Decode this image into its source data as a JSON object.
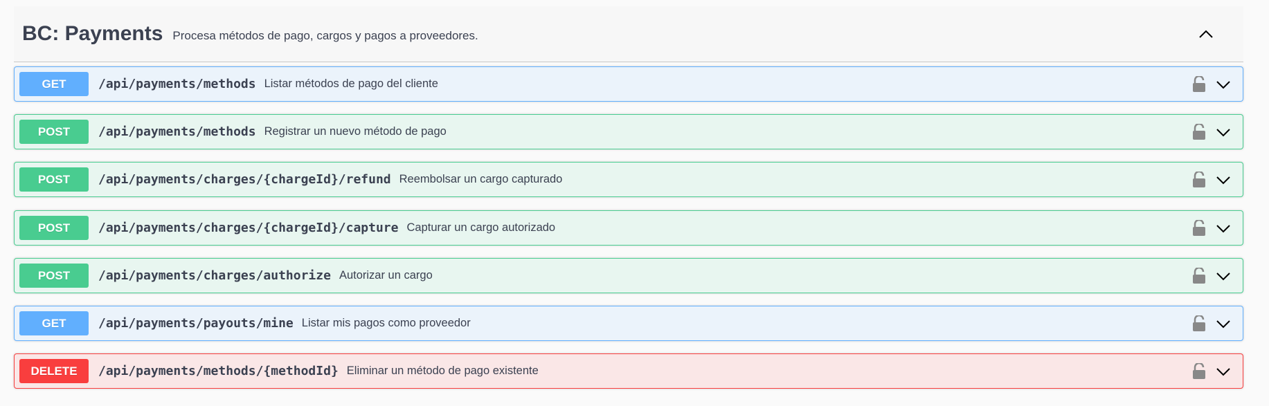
{
  "tag": {
    "title": "BC: Payments",
    "description": "Procesa métodos de pago, cargos y pagos a proveedores.",
    "collapse_icon": "chevron-up-icon"
  },
  "operations": [
    {
      "method": "GET",
      "path": "/api/payments/methods",
      "summary": "Listar métodos de pago del cliente"
    },
    {
      "method": "POST",
      "path": "/api/payments/methods",
      "summary": "Registrar un nuevo método de pago"
    },
    {
      "method": "POST",
      "path": "/api/payments/charges/{chargeId}/refund",
      "summary": "Reembolsar un cargo capturado"
    },
    {
      "method": "POST",
      "path": "/api/payments/charges/{chargeId}/capture",
      "summary": "Capturar un cargo autorizado"
    },
    {
      "method": "POST",
      "path": "/api/payments/charges/authorize",
      "summary": "Autorizar un cargo"
    },
    {
      "method": "GET",
      "path": "/api/payments/payouts/mine",
      "summary": "Listar mis pagos como proveedor"
    },
    {
      "method": "DELETE",
      "path": "/api/payments/methods/{methodId}",
      "summary": "Eliminar un método de pago existente"
    }
  ],
  "icons": {
    "lock": "unlocked-padlock-icon",
    "expand": "chevron-down-icon"
  },
  "colors": {
    "get": "#61affe",
    "post": "#49cc90",
    "delete": "#f93e3e"
  }
}
